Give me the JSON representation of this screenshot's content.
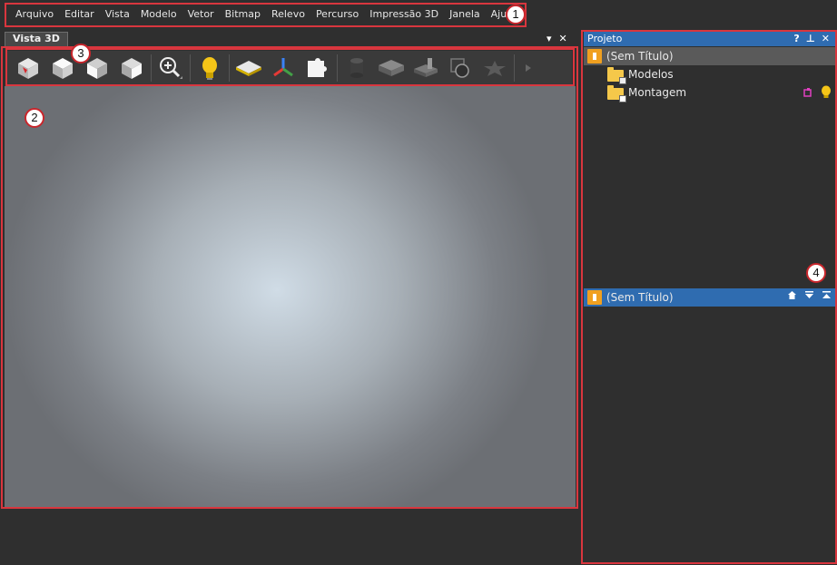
{
  "menubar": {
    "items": [
      "Arquivo",
      "Editar",
      "Vista",
      "Modelo",
      "Vetor",
      "Bitmap",
      "Relevo",
      "Percurso",
      "Impressão 3D",
      "Janela",
      "Ajuda"
    ]
  },
  "callouts": [
    "1",
    "2",
    "3",
    "4"
  ],
  "view3d": {
    "tab_label": "Vista 3D",
    "dropdown_icon": "▾",
    "close_icon": "✕"
  },
  "project": {
    "title": "Projeto",
    "help": "?",
    "pin": "⊥",
    "close": "✕",
    "root_label": "(Sem Título)",
    "items": [
      "Modelos",
      "Montagem"
    ],
    "lower_root_label": "(Sem Título)"
  },
  "colors": {
    "highlight_red": "#d9363e",
    "header_blue": "#2f6cb0",
    "background": "#2f2f2f"
  }
}
